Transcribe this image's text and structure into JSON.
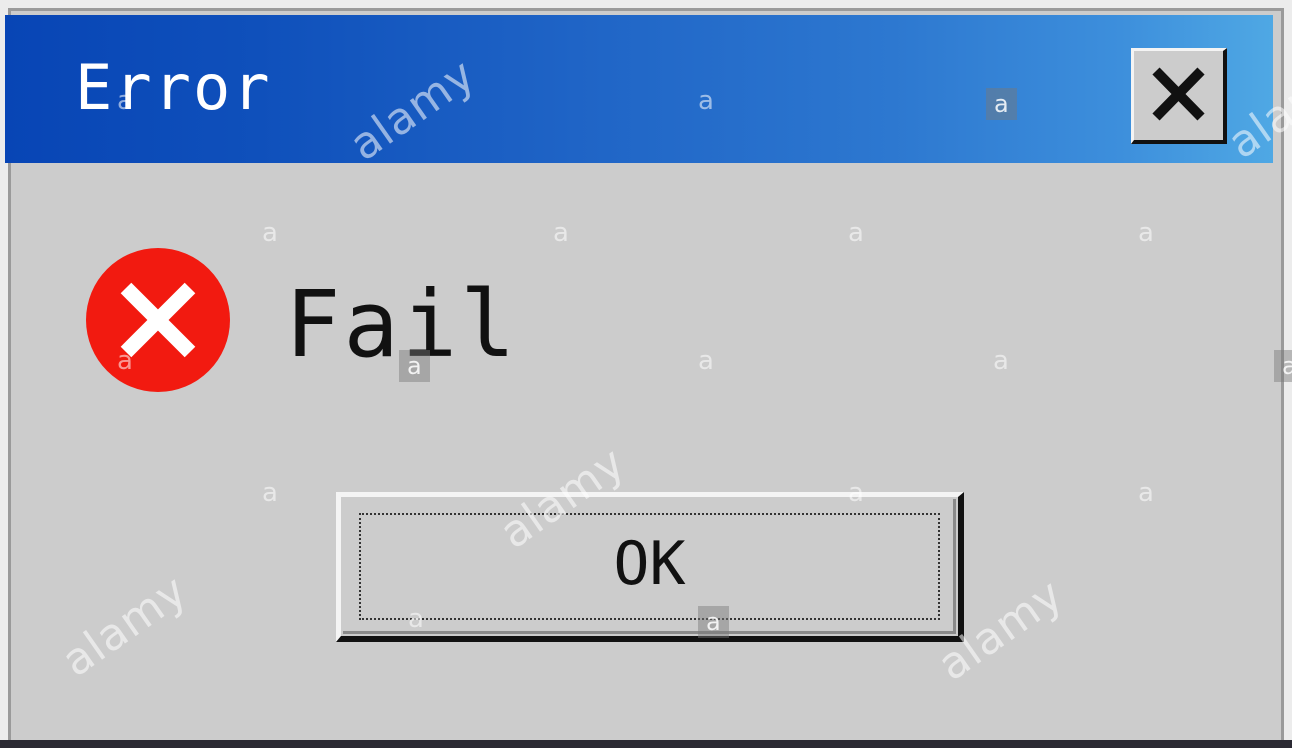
{
  "window": {
    "title": "Error",
    "close_icon": "close-x-icon",
    "title_bar_colors": [
      "#0845b5",
      "#4fa8e4"
    ]
  },
  "dialog": {
    "icon": "error-x-circle-icon",
    "icon_color": "#f21a10",
    "message": "Fail",
    "ok_label": "OK"
  },
  "watermark": {
    "brand": "alamy",
    "mark": "a"
  }
}
